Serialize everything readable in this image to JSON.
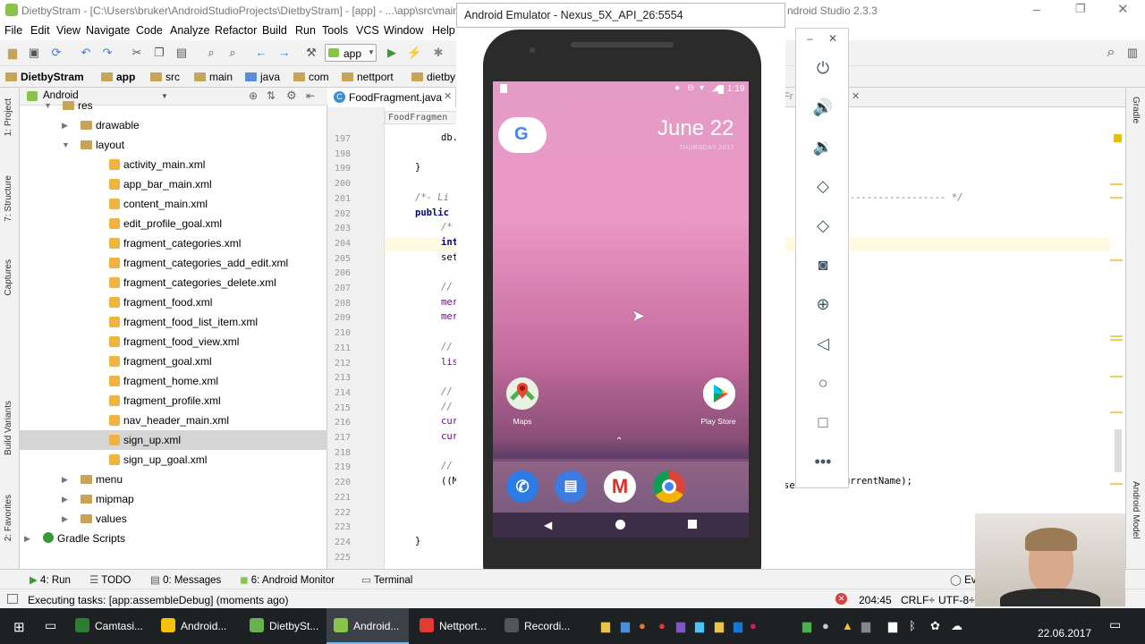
{
  "window": {
    "title": "DietbyStram - [C:\\Users\\bruker\\AndroidStudioProjects\\DietbyStram] - [app] - ...\\app\\src\\main",
    "title_tail": "ndroid Studio 2.3.3"
  },
  "menu": [
    "File",
    "Edit",
    "View",
    "Navigate",
    "Code",
    "Analyze",
    "Refactor",
    "Build",
    "Run",
    "Tools",
    "VCS",
    "Window",
    "Help"
  ],
  "toolbar": {
    "run_config": "app"
  },
  "breadcrumbs": [
    "DietbyStram",
    "app",
    "src",
    "main",
    "java",
    "com",
    "nettport",
    "dietby"
  ],
  "project": {
    "view_mode": "Android",
    "tree": [
      {
        "label": "res",
        "indent": 1,
        "type": "folder",
        "expanded": true
      },
      {
        "label": "drawable",
        "indent": 2,
        "type": "folder",
        "expanded": false
      },
      {
        "label": "layout",
        "indent": 2,
        "type": "folder",
        "expanded": true
      },
      {
        "label": "activity_main.xml",
        "indent": 3,
        "type": "xml"
      },
      {
        "label": "app_bar_main.xml",
        "indent": 3,
        "type": "xml"
      },
      {
        "label": "content_main.xml",
        "indent": 3,
        "type": "xml"
      },
      {
        "label": "edit_profile_goal.xml",
        "indent": 3,
        "type": "xml"
      },
      {
        "label": "fragment_categories.xml",
        "indent": 3,
        "type": "xml"
      },
      {
        "label": "fragment_categories_add_edit.xml",
        "indent": 3,
        "type": "xml"
      },
      {
        "label": "fragment_categories_delete.xml",
        "indent": 3,
        "type": "xml"
      },
      {
        "label": "fragment_food.xml",
        "indent": 3,
        "type": "xml"
      },
      {
        "label": "fragment_food_list_item.xml",
        "indent": 3,
        "type": "xml"
      },
      {
        "label": "fragment_food_view.xml",
        "indent": 3,
        "type": "xml"
      },
      {
        "label": "fragment_goal.xml",
        "indent": 3,
        "type": "xml"
      },
      {
        "label": "fragment_home.xml",
        "indent": 3,
        "type": "xml"
      },
      {
        "label": "fragment_profile.xml",
        "indent": 3,
        "type": "xml"
      },
      {
        "label": "nav_header_main.xml",
        "indent": 3,
        "type": "xml"
      },
      {
        "label": "sign_up.xml",
        "indent": 3,
        "type": "xml",
        "selected": true
      },
      {
        "label": "sign_up_goal.xml",
        "indent": 3,
        "type": "xml"
      },
      {
        "label": "menu",
        "indent": 2,
        "type": "folder",
        "expanded": false
      },
      {
        "label": "mipmap",
        "indent": 2,
        "type": "folder",
        "expanded": false
      },
      {
        "label": "values",
        "indent": 2,
        "type": "folder",
        "expanded": false
      },
      {
        "label": "Gradle Scripts",
        "indent": 0,
        "type": "gradle",
        "expanded": false
      }
    ]
  },
  "left_tabs": [
    "1: Project",
    "7: Structure",
    "Captures",
    "Build Variants",
    "2: Favorites"
  ],
  "right_tabs": [
    "Gradle",
    "Android Model"
  ],
  "editor": {
    "tab": "FoodFragment.java",
    "scope": "FoodFragmen",
    "line_numbers": [
      "197",
      "198",
      "199",
      "200",
      "201",
      "202",
      "203",
      "204",
      "205",
      "206",
      "207",
      "208",
      "209",
      "210",
      "211",
      "212",
      "213",
      "214",
      "215",
      "216",
      "217",
      "218",
      "219",
      "220",
      "221",
      "222",
      "223",
      "224",
      "225"
    ],
    "code": [
      {
        "line": "197",
        "text": "db."
      },
      {
        "line": "199",
        "text": "}"
      },
      {
        "line": "201",
        "text": "/*- Li"
      },
      {
        "line": "202",
        "text": "public"
      },
      {
        "line": "203",
        "text": "/*"
      },
      {
        "line": "204",
        "text": "int"
      },
      {
        "line": "205",
        "text": "set"
      },
      {
        "line": "207",
        "text": "//"
      },
      {
        "line": "208",
        "text": "mer"
      },
      {
        "line": "209",
        "text": "mer"
      },
      {
        "line": "211",
        "text": "//"
      },
      {
        "line": "212",
        "text": "lis"
      },
      {
        "line": "214",
        "text": "//"
      },
      {
        "line": "215",
        "text": "//"
      },
      {
        "line": "216",
        "text": "cur"
      },
      {
        "line": "217",
        "text": "cur"
      },
      {
        "line": "219",
        "text": "//"
      },
      {
        "line": "220",
        "text": "((M"
      },
      {
        "line": "224",
        "text": "}"
      }
    ],
    "right_code": [
      {
        "line": "201",
        "text": "----------------- */"
      },
      {
        "line": "220",
        "text": "urrentName);"
      }
    ],
    "right_code_fragment": "se",
    "hidden_tab_fragment": "Fr"
  },
  "emulator": {
    "title": "Android Emulator - Nexus_5X_API_26:5554",
    "status_time": "1:19",
    "date": "June 22",
    "weekday": "THURSDAY 2017",
    "apps": [
      {
        "label": "Maps",
        "icon": "maps-icon"
      },
      {
        "label": "Play Store",
        "icon": "play-store-icon"
      }
    ],
    "dock": [
      "phone-icon",
      "messages-icon",
      "gmail-icon",
      "chrome-icon"
    ]
  },
  "side_controls": [
    "power",
    "volume-up",
    "volume-down",
    "rotate-left",
    "rotate-right",
    "screenshot",
    "zoom",
    "back",
    "home",
    "overview",
    "more"
  ],
  "bottom_tabs": [
    "4: Run",
    "TODO",
    "0: Messages",
    "6: Android Monitor",
    "Terminal"
  ],
  "bottom_right": "Ev",
  "status": {
    "message": "Executing tasks: [app:assembleDebug] (moments ago)",
    "position": "204:45",
    "line_sep": "CRLF÷",
    "encoding": "UTF-8÷"
  },
  "taskbar": {
    "items": [
      {
        "label": "Camtasi...",
        "color": "#2e7d32"
      },
      {
        "label": "Android...",
        "color": "#f4c20d"
      },
      {
        "label": "DietbySt...",
        "color": "#6ab04c"
      },
      {
        "label": "Android...",
        "color": "#8bc34a",
        "active": true
      },
      {
        "label": "Nettport...",
        "color": "#e53935"
      },
      {
        "label": "Recordi...",
        "color": "#555"
      }
    ],
    "date": "22.06.2017"
  }
}
